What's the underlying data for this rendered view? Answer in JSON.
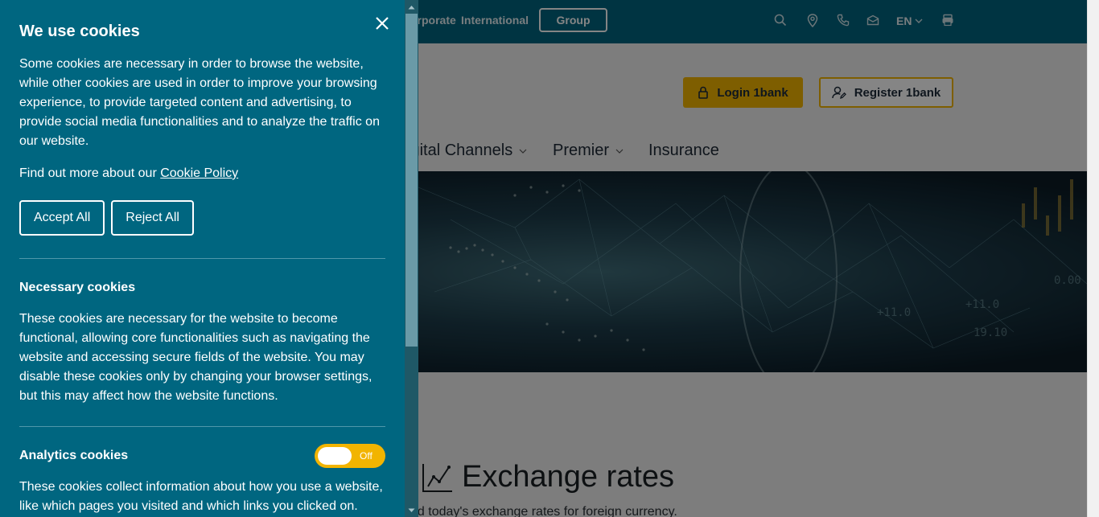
{
  "topbar": {
    "links": [
      "orporate",
      "International"
    ],
    "group_button": "Group",
    "language": "EN",
    "icons": [
      "search-icon",
      "location-pin-icon",
      "phone-icon",
      "mail-icon",
      "chevron-down-icon",
      "printer-icon"
    ]
  },
  "header": {
    "login_label": "Login 1bank",
    "register_label": "Register 1bank"
  },
  "main_nav": [
    {
      "label": "igital Channels",
      "has_dropdown": true
    },
    {
      "label": "Premier",
      "has_dropdown": true
    },
    {
      "label": "Insurance",
      "has_dropdown": false
    }
  ],
  "exchange": {
    "title": "Exchange rates",
    "subtitle": "nd today's exchange rates for foreign currency."
  },
  "cookie": {
    "title": "We use cookies",
    "intro": "Some cookies are necessary in order to browse the website, while other cookies are used in order to improve your browsing experience, to provide targeted content and advertising, to provide social media functionalities and to analyze the traffic on our website.",
    "more_prefix": "Find out more about our ",
    "policy_link": "Cookie Policy",
    "accept_label": "Accept All",
    "reject_label": "Reject All",
    "sections": [
      {
        "title": "Necessary cookies",
        "text": "These cookies are necessary for the website to become functional, allowing core functionalities such as navigating the website and accessing secure fields of the website. You may disable these cookies only by changing your browser settings, but this may affect how the website functions."
      },
      {
        "title": "Analytics cookies",
        "toggle_label": "Off",
        "toggle_on": false,
        "text": "These cookies collect information about how you use a website, like which pages you visited and which links you clicked on."
      }
    ]
  },
  "colors": {
    "panel": "#006680",
    "topbar": "#00657f",
    "accent": "#f2b400"
  }
}
